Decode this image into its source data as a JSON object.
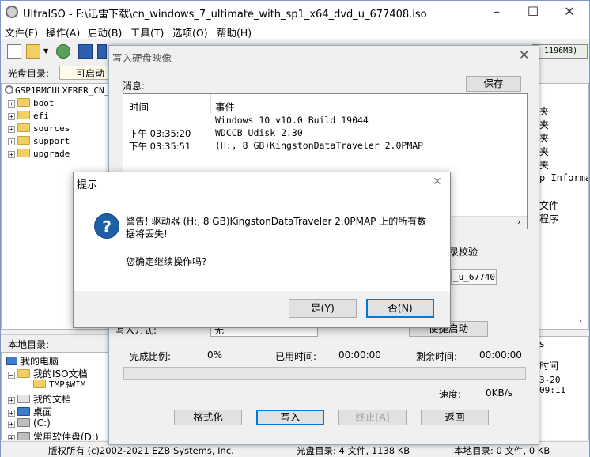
{
  "app": {
    "title": "UltraISO - F:\\迅雷下载\\cn_windows_7_ultimate_with_sp1_x64_dvd_u_677408.iso",
    "size_readout": "- 1196MB)"
  },
  "menu": [
    "文件(F)",
    "操作(A)",
    "启动(B)",
    "工具(T)",
    "选项(O)",
    "帮助(H)"
  ],
  "iso_panel": {
    "label": "光盘目录:",
    "boot_value": "可启动",
    "root": "GSP1RMCULXFRER_CN_D",
    "folders": [
      "boot",
      "efi",
      "sources",
      "support",
      "upgrade"
    ]
  },
  "right_list": [
    "夹",
    "夹",
    "夹",
    "夹",
    "夹",
    "p Informat",
    "文件",
    "程序"
  ],
  "local_panel": {
    "label": "本地目录:",
    "items": [
      "我的电脑",
      "我的ISO文档",
      "TMP$WIM",
      "我的文档",
      "桌面",
      "(C:)",
      "常用软件盘(D:)"
    ]
  },
  "right_bottom": [
    "s",
    "时间",
    "3-20 09:11"
  ],
  "statusbar": {
    "copyright": "版权所有 (c)2002-2021 EZB Systems, Inc.",
    "iso_dir": "光盘目录: 4 文件, 1138 KB",
    "local_dir": "本地目录: 0 文件, 0 KB"
  },
  "write_dialog": {
    "title": "写入硬盘映像",
    "msg_label": "消息:",
    "save_button": "保存",
    "col_time": "时间",
    "col_event": "事件",
    "rows": [
      {
        "time": "",
        "event": "Windows 10 v10.0 Build 19044"
      },
      {
        "time": "下午 03:35:20",
        "event": "WDCCB   Udisk          2.30"
      },
      {
        "time": "下午 03:35:51",
        "event": "(H:, 8 GB)KingstonDataTraveler 2.0PMAP"
      }
    ],
    "verify_label": "录校验",
    "file_field": "_u_677408",
    "method_label": "写入方式:",
    "method_value": "无",
    "boot_button": "便捷启动",
    "complete_label": "完成比例:",
    "complete_value": "0%",
    "elapsed_label": "已用时间:",
    "elapsed_value": "00:00:00",
    "remain_label": "剩余时间:",
    "remain_value": "00:00:00",
    "speed_label": "速度:",
    "speed_value": "0KB/s",
    "progress": 0,
    "buttons": {
      "format": "格式化",
      "write": "写入",
      "stop": "终止[A]",
      "back": "返回"
    }
  },
  "confirm_dialog": {
    "title": "提示",
    "warning": "警告! 驱动器 (H:, 8 GB)KingstonDataTraveler 2.0PMAP 上的所有数据将丢失!",
    "question": "您确定继续操作吗?",
    "yes": "是(Y)",
    "no": "否(N)"
  }
}
